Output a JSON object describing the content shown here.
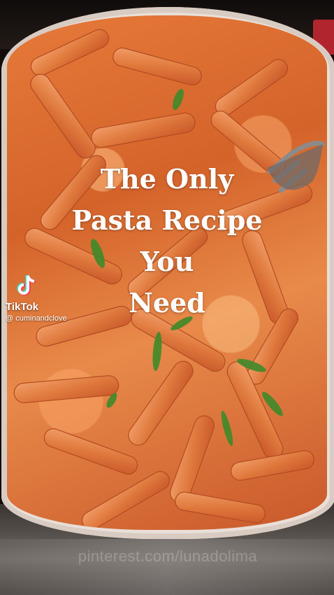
{
  "overlay": {
    "headline_lines": [
      "The Only",
      "Pasta Recipe",
      "You",
      "Need"
    ]
  },
  "tiktok": {
    "brand": "TikTok",
    "handle": "@ cuminandclove"
  },
  "watermark": {
    "text": "pinterest.com/lunadolima"
  },
  "colors": {
    "sauce": "#d4632a",
    "basil": "#3f8a2a",
    "headline_text": "#ffffff"
  },
  "icons": {
    "brand_logo": "tiktok-logo-icon"
  }
}
